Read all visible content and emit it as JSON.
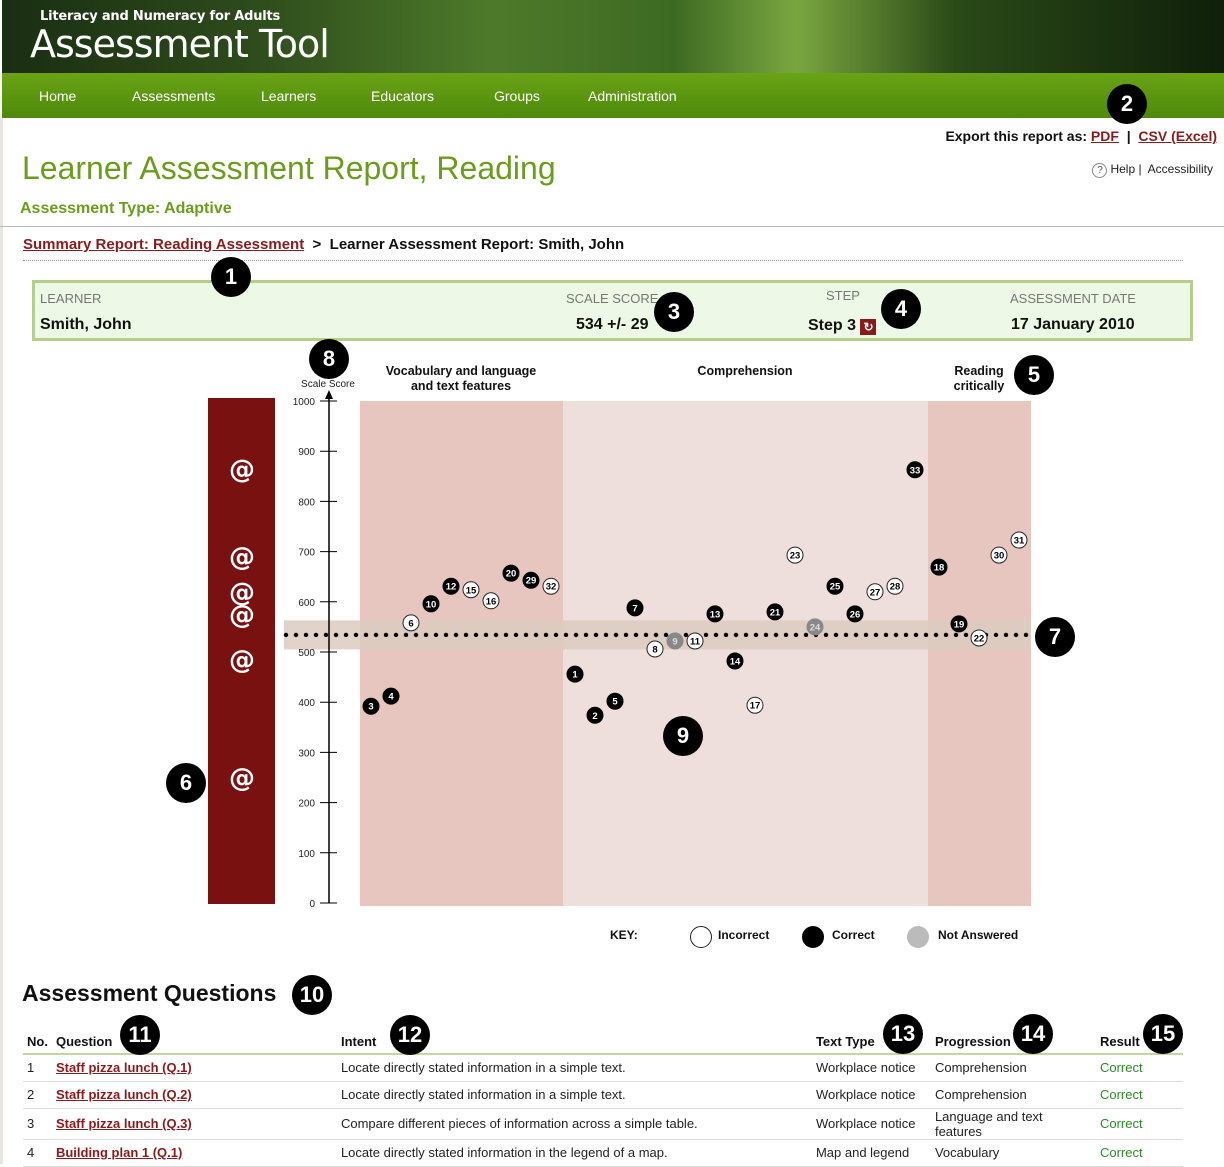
{
  "header": {
    "subtitle": "Literacy and Numeracy for Adults",
    "title": "Assessment Tool"
  },
  "nav": {
    "items": [
      {
        "label": "Home"
      },
      {
        "label": "Assessments"
      },
      {
        "label": "Learners"
      },
      {
        "label": "Educators"
      },
      {
        "label": "Groups"
      },
      {
        "label": "Administration"
      }
    ]
  },
  "export": {
    "label": "Export this report as:",
    "pdf": "PDF",
    "separator": "|",
    "csv": "CSV (Excel)"
  },
  "help": {
    "icon": "help-circle-icon",
    "help_label": "Help",
    "separator": "|",
    "accessibility_label": "Accessibility"
  },
  "page": {
    "title": "Learner Assessment Report, Reading",
    "assessment_type": "Assessment Type: Adaptive"
  },
  "breadcrumb": {
    "link": "Summary Report: Reading Assessment",
    "separator": ">",
    "current": "Learner Assessment Report: Smith, John"
  },
  "summary": {
    "learner_label": "LEARNER",
    "learner": "Smith, John",
    "scale_score_label": "SCALE SCORE",
    "scale_score": "534 +/- 29",
    "step_label": "STEP",
    "step": "Step 3",
    "step_icon": "koru-icon",
    "date_label": "ASSESSMENT DATE",
    "date": "17 January 2010"
  },
  "callouts": [
    "1",
    "2",
    "3",
    "4",
    "5",
    "6",
    "7",
    "8",
    "9",
    "10",
    "11",
    "12",
    "13",
    "14",
    "15"
  ],
  "chart_data": {
    "type": "scatter",
    "ylabel": "Scale Score",
    "ylim": [
      0,
      1000
    ],
    "yticks": [
      0,
      100,
      200,
      300,
      400,
      500,
      600,
      700,
      800,
      900,
      1000
    ],
    "learner_score": 534,
    "learner_score_error": 29,
    "bands": [
      {
        "name": "Vocabulary and language and text features",
        "label_lines": [
          "Vocabulary and language",
          "and text features"
        ]
      },
      {
        "name": "Comprehension",
        "label_lines": [
          "Comprehension"
        ]
      },
      {
        "name": "Reading critically",
        "label_lines": [
          "Reading",
          "critically"
        ]
      }
    ],
    "step_koru_count": 6,
    "step_koru_scores": [
      865,
      690,
      620,
      575,
      485,
      250
    ],
    "points": [
      {
        "q": 3,
        "band": 0,
        "order": 0,
        "score": 392,
        "result": "correct"
      },
      {
        "q": 4,
        "band": 0,
        "order": 1,
        "score": 412,
        "result": "correct"
      },
      {
        "q": 6,
        "band": 0,
        "order": 2,
        "score": 558,
        "result": "incorrect"
      },
      {
        "q": 10,
        "band": 0,
        "order": 3,
        "score": 596,
        "result": "correct"
      },
      {
        "q": 12,
        "band": 0,
        "order": 4,
        "score": 631,
        "result": "correct"
      },
      {
        "q": 15,
        "band": 0,
        "order": 5,
        "score": 624,
        "result": "incorrect"
      },
      {
        "q": 16,
        "band": 0,
        "order": 6,
        "score": 602,
        "result": "incorrect"
      },
      {
        "q": 20,
        "band": 0,
        "order": 7,
        "score": 657,
        "result": "correct"
      },
      {
        "q": 29,
        "band": 0,
        "order": 8,
        "score": 643,
        "result": "correct"
      },
      {
        "q": 32,
        "band": 0,
        "order": 9,
        "score": 631,
        "result": "incorrect"
      },
      {
        "q": 1,
        "band": 1,
        "order": 0,
        "score": 456,
        "result": "correct"
      },
      {
        "q": 2,
        "band": 1,
        "order": 1,
        "score": 374,
        "result": "correct"
      },
      {
        "q": 5,
        "band": 1,
        "order": 2,
        "score": 402,
        "result": "correct"
      },
      {
        "q": 7,
        "band": 1,
        "order": 3,
        "score": 588,
        "result": "correct"
      },
      {
        "q": 8,
        "band": 1,
        "order": 4,
        "score": 506,
        "result": "incorrect"
      },
      {
        "q": 9,
        "band": 1,
        "order": 5,
        "score": 522,
        "result": "not_answered"
      },
      {
        "q": 11,
        "band": 1,
        "order": 6,
        "score": 522,
        "result": "incorrect"
      },
      {
        "q": 13,
        "band": 1,
        "order": 7,
        "score": 576,
        "result": "correct"
      },
      {
        "q": 14,
        "band": 1,
        "order": 8,
        "score": 482,
        "result": "correct"
      },
      {
        "q": 17,
        "band": 1,
        "order": 9,
        "score": 394,
        "result": "incorrect"
      },
      {
        "q": 21,
        "band": 1,
        "order": 10,
        "score": 580,
        "result": "correct"
      },
      {
        "q": 23,
        "band": 1,
        "order": 11,
        "score": 693,
        "result": "incorrect"
      },
      {
        "q": 24,
        "band": 1,
        "order": 12,
        "score": 550,
        "result": "not_answered"
      },
      {
        "q": 25,
        "band": 1,
        "order": 13,
        "score": 631,
        "result": "correct"
      },
      {
        "q": 26,
        "band": 1,
        "order": 14,
        "score": 576,
        "result": "correct"
      },
      {
        "q": 27,
        "band": 1,
        "order": 15,
        "score": 620,
        "result": "incorrect"
      },
      {
        "q": 28,
        "band": 1,
        "order": 16,
        "score": 631,
        "result": "incorrect"
      },
      {
        "q": 33,
        "band": 1,
        "order": 17,
        "score": 863,
        "result": "correct"
      },
      {
        "q": 18,
        "band": 2,
        "order": 0,
        "score": 669,
        "result": "correct"
      },
      {
        "q": 19,
        "band": 2,
        "order": 1,
        "score": 556,
        "result": "correct"
      },
      {
        "q": 22,
        "band": 2,
        "order": 2,
        "score": 528,
        "result": "incorrect"
      },
      {
        "q": 30,
        "band": 2,
        "order": 3,
        "score": 693,
        "result": "incorrect"
      },
      {
        "q": 31,
        "band": 2,
        "order": 4,
        "score": 723,
        "result": "incorrect"
      }
    ],
    "key": {
      "label": "KEY:",
      "items": [
        {
          "label": "Incorrect",
          "result": "incorrect"
        },
        {
          "label": "Correct",
          "result": "correct"
        },
        {
          "label": "Not Answered",
          "result": "not_answered"
        }
      ]
    },
    "colors": {
      "band_dark": "#e8c6c0",
      "band_light": "#efdfdc",
      "step_bar": "#7a1111",
      "score_band": "#dccbc0",
      "correct": "#000000",
      "incorrect": "#ffffff",
      "not_answered": "#888888"
    }
  },
  "questions": {
    "heading": "Assessment Questions",
    "columns": [
      "No.",
      "Question",
      "Intent",
      "Text Type",
      "Progression",
      "Result"
    ],
    "rows": [
      {
        "no": "1",
        "question": "Staff pizza lunch (Q.1)",
        "intent": "Locate directly stated information in a simple text.",
        "text_type": "Workplace notice",
        "progression": "Comprehension",
        "result": "Correct"
      },
      {
        "no": "2",
        "question": "Staff pizza lunch (Q.2)",
        "intent": "Locate directly stated information in a simple text.",
        "text_type": "Workplace notice",
        "progression": "Comprehension",
        "result": "Correct"
      },
      {
        "no": "3",
        "question": "Staff pizza lunch (Q.3)",
        "intent": "Compare different pieces of information across a simple table.",
        "text_type": "Workplace notice",
        "progression": "Language and text features",
        "result": "Correct"
      },
      {
        "no": "4",
        "question": "Building plan 1 (Q.1)",
        "intent": "Locate directly stated information in the legend of a map.",
        "text_type": "Map and legend",
        "progression": "Vocabulary",
        "result": "Correct"
      }
    ]
  }
}
